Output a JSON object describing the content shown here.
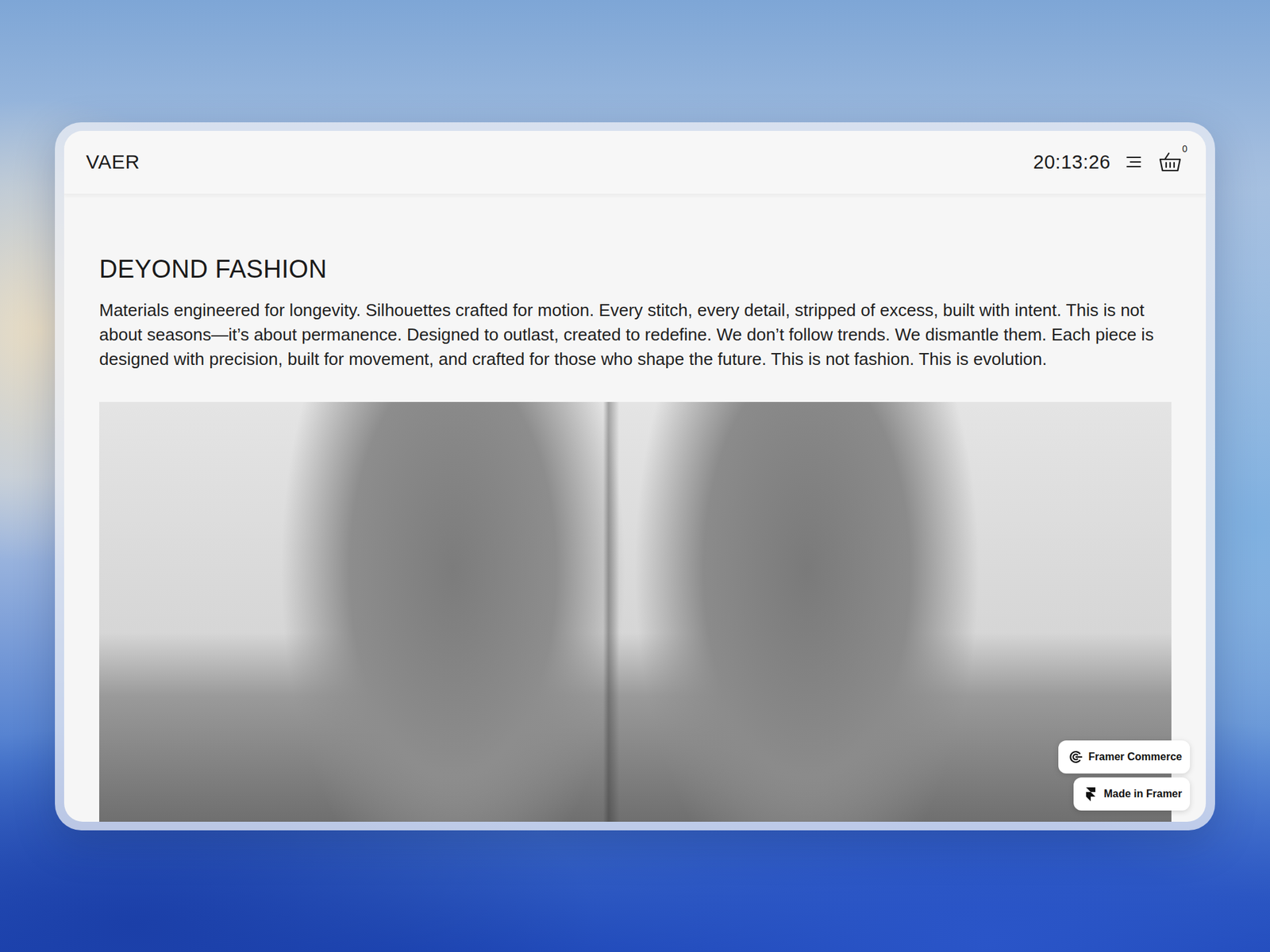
{
  "header": {
    "logo": "VAER",
    "time": "20:13:26",
    "cart_count": "0"
  },
  "hero": {
    "title": "DEYOND FASHION",
    "body": "Materials engineered for longevity. Silhouettes crafted for motion. Every stitch, every detail, stripped of excess, built with intent. This is not about seasons—it’s about permanence. Designed to outlast, created to redefine. We don’t follow trends. We dismantle them. Each piece is designed with precision, built for movement, and crafted for those who shape the future. This is not fashion. This is evolution."
  },
  "badges": [
    {
      "label": "Framer Commerce",
      "kind": "commerce"
    },
    {
      "label": "Made in Framer",
      "kind": "framer"
    }
  ]
}
